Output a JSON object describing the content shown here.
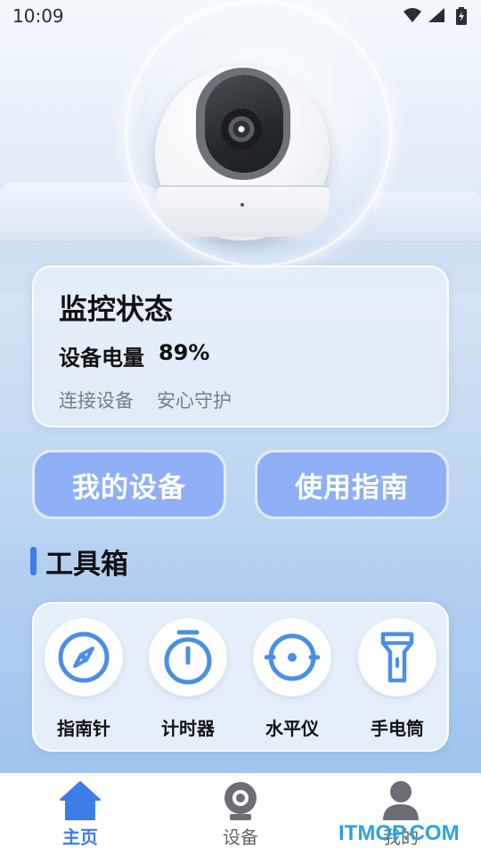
{
  "status_bar": {
    "time": "10:09"
  },
  "status_card": {
    "title": "监控状态",
    "battery_label": "设备电量",
    "battery_value": "89%",
    "sub_texts": [
      "连接设备",
      "安心守护"
    ]
  },
  "actions": {
    "my_devices": "我的设备",
    "guide": "使用指南"
  },
  "toolbox": {
    "heading": "工具箱",
    "tools": [
      {
        "label": "指南针",
        "icon": "compass-icon"
      },
      {
        "label": "计时器",
        "icon": "timer-icon"
      },
      {
        "label": "水平仪",
        "icon": "level-icon"
      },
      {
        "label": "手电筒",
        "icon": "flashlight-icon"
      }
    ]
  },
  "bottom_nav": {
    "items": [
      {
        "label": "主页",
        "icon": "home-icon",
        "active": true
      },
      {
        "label": "设备",
        "icon": "camera-icon",
        "active": false
      },
      {
        "label": "我的",
        "icon": "user-icon",
        "active": false
      }
    ]
  },
  "watermark": "ITMOP.COM",
  "colors": {
    "accent": "#3d7de8",
    "button": "#8fb0f7",
    "icon": "#4a8fe6"
  }
}
